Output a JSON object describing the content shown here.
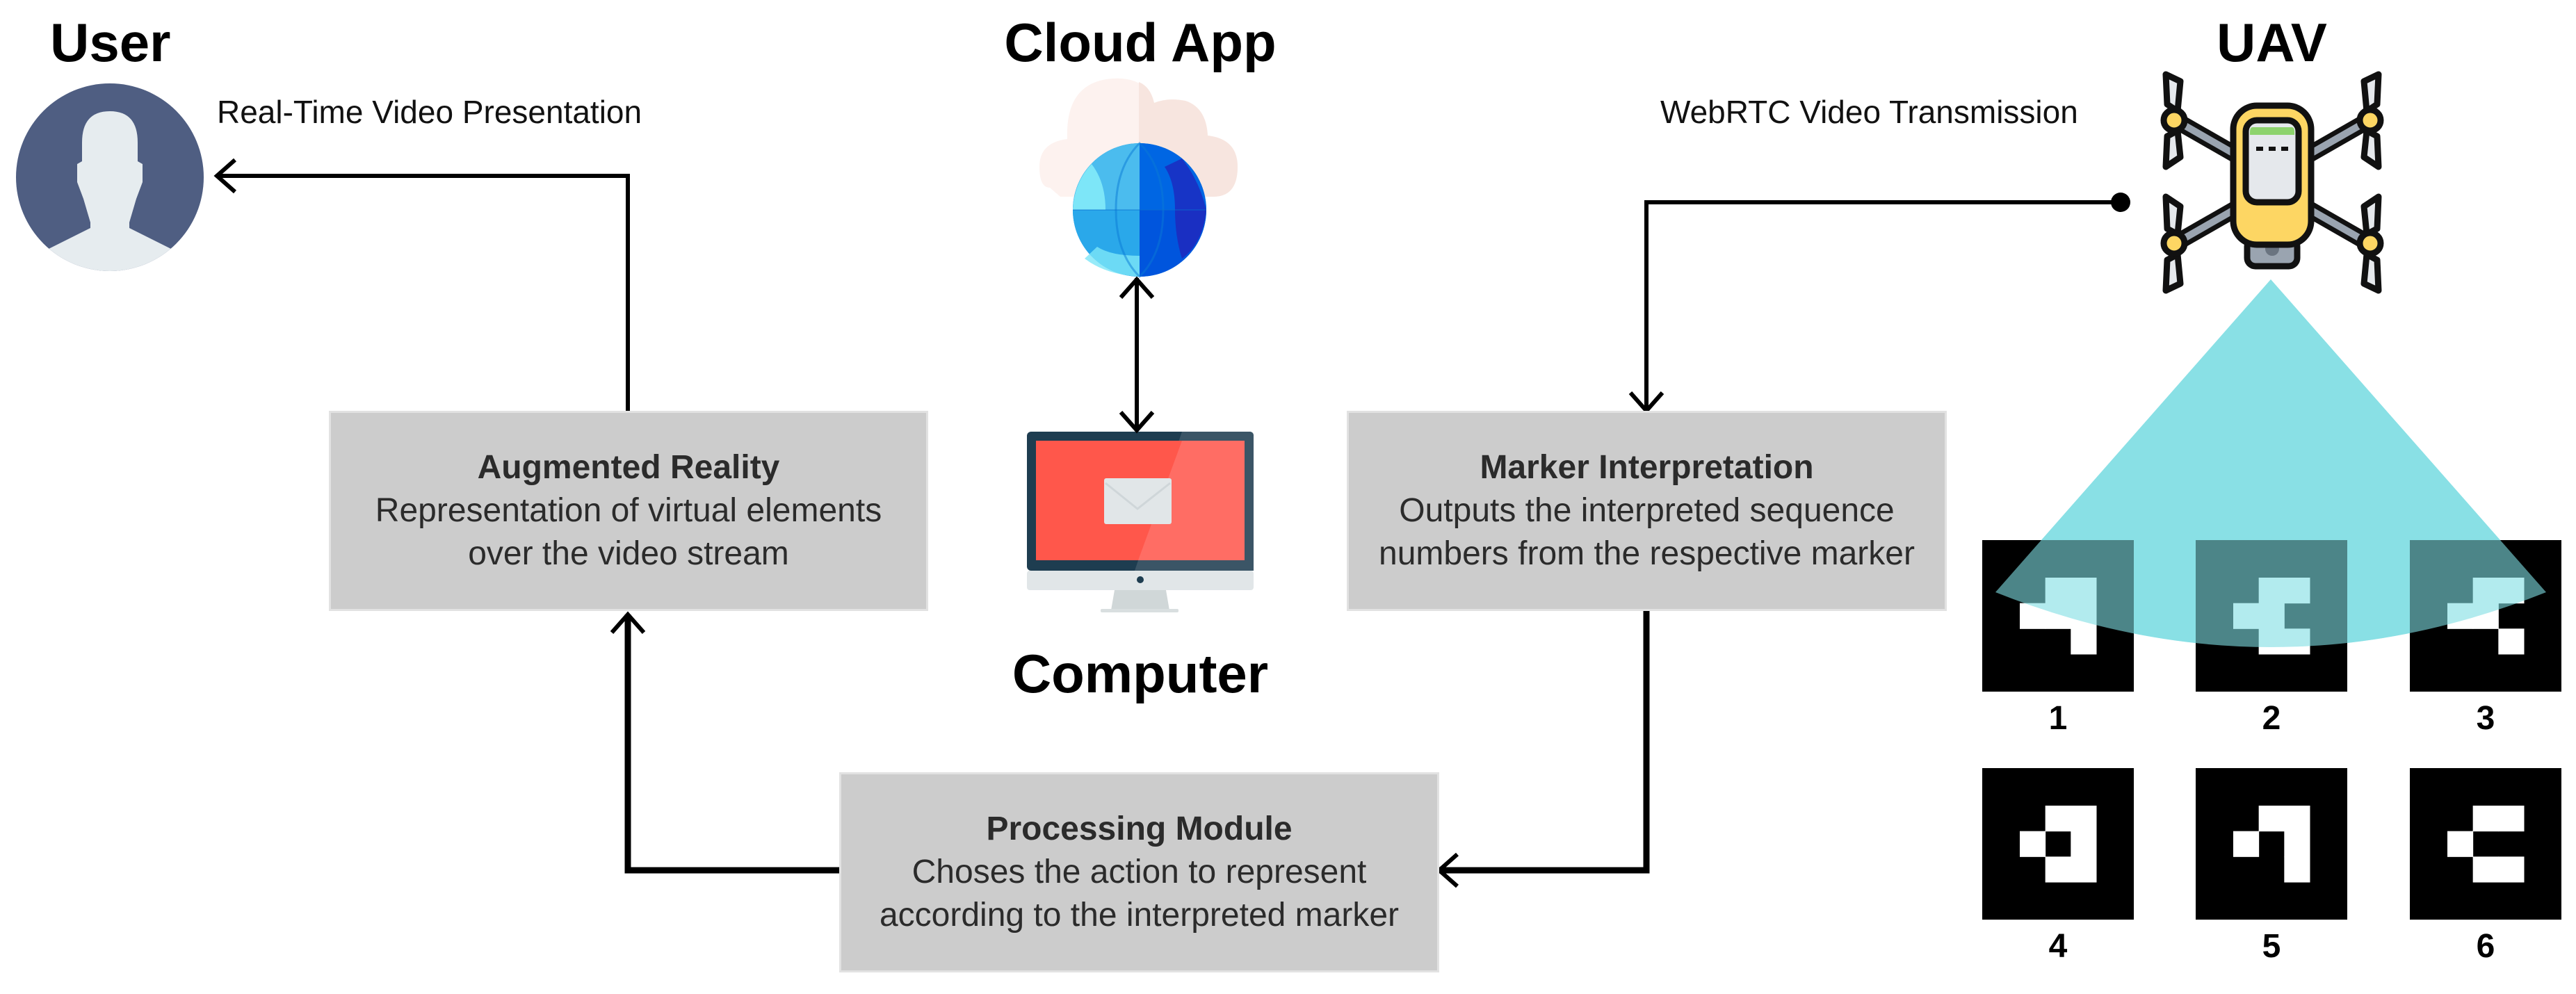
{
  "nodes": {
    "user": {
      "title": "User",
      "icon": "user-avatar-icon"
    },
    "cloud_app": {
      "title": "Cloud App",
      "icon": "cloud-globe-icon"
    },
    "computer": {
      "title": "Computer",
      "icon": "monitor-mail-icon"
    },
    "uav": {
      "title": "UAV",
      "icon": "drone-icon"
    }
  },
  "edges": {
    "real_time_video": "Real-Time Video Presentation",
    "webrtc_video": "WebRTC Video Transmission"
  },
  "boxes": {
    "augmented_reality": {
      "title": "Augmented Reality",
      "lines": [
        "Representation of virtual elements",
        "over the video stream"
      ]
    },
    "marker_interpretation": {
      "title": "Marker Interpretation",
      "lines": [
        "Outputs the interpreted sequence",
        "numbers from the respective marker"
      ]
    },
    "processing_module": {
      "title": "Processing Module",
      "lines": [
        "Choses the action to represent",
        "according to the interpreted marker"
      ]
    }
  },
  "markers": [
    {
      "label": "1",
      "bits": [
        [
          0,
          1,
          1
        ],
        [
          1,
          1,
          1
        ],
        [
          0,
          0,
          1
        ]
      ]
    },
    {
      "label": "2",
      "bits": [
        [
          0,
          1,
          1
        ],
        [
          1,
          1,
          0
        ],
        [
          0,
          1,
          1
        ]
      ]
    },
    {
      "label": "3",
      "bits": [
        [
          0,
          1,
          1
        ],
        [
          1,
          1,
          0
        ],
        [
          0,
          0,
          1
        ]
      ]
    },
    {
      "label": "4",
      "bits": [
        [
          0,
          1,
          1
        ],
        [
          1,
          0,
          1
        ],
        [
          0,
          1,
          1
        ]
      ]
    },
    {
      "label": "5",
      "bits": [
        [
          0,
          1,
          1
        ],
        [
          1,
          0,
          1
        ],
        [
          0,
          0,
          1
        ]
      ]
    },
    {
      "label": "6",
      "bits": [
        [
          0,
          1,
          1
        ],
        [
          1,
          0,
          0
        ],
        [
          0,
          1,
          1
        ]
      ]
    }
  ],
  "colors": {
    "box_fill": "#cccccc",
    "avatar_bg": "#4f5e82",
    "avatar_fg": "#e6ecef",
    "camera_cone": "#7fdde3",
    "screen_red": "#ff574b",
    "drone_yellow": "#fdd663"
  }
}
